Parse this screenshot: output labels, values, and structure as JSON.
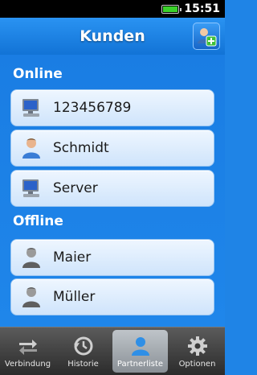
{
  "status": {
    "time": "15:51"
  },
  "header": {
    "title": "Kunden"
  },
  "sections": {
    "online": {
      "title": "Online",
      "items": [
        {
          "label": "123456789",
          "icon": "computer-icon"
        },
        {
          "label": "Schmidt",
          "icon": "person-online-icon"
        },
        {
          "label": "Server",
          "icon": "computer-icon"
        }
      ]
    },
    "offline": {
      "title": "Offline",
      "items": [
        {
          "label": "Maier",
          "icon": "person-offline-icon"
        },
        {
          "label": "Müller",
          "icon": "person-offline-icon"
        }
      ]
    }
  },
  "tabs": [
    {
      "label": "Verbindung",
      "icon": "arrows-icon"
    },
    {
      "label": "Historie",
      "icon": "history-icon"
    },
    {
      "label": "Partnerliste",
      "icon": "person-icon",
      "active": true
    },
    {
      "label": "Optionen",
      "icon": "gear-icon"
    }
  ],
  "colors": {
    "background": "#1f84e6",
    "online_person": "#3a7dd6",
    "offline_person": "#5f5f5f"
  }
}
